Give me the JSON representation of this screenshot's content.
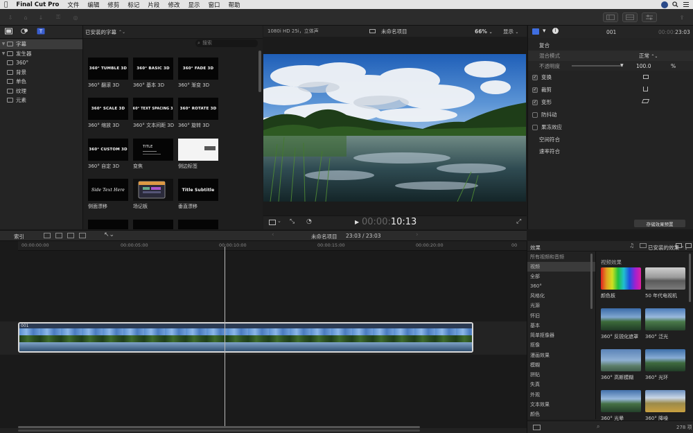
{
  "menubar": {
    "app_name": "Final Cut Pro",
    "items": [
      "文件",
      "编辑",
      "修剪",
      "标记",
      "片段",
      "修改",
      "显示",
      "窗口",
      "帮助"
    ]
  },
  "library": {
    "items": [
      {
        "label": "字幕",
        "expanded": true,
        "selected": true,
        "level": 0
      },
      {
        "label": "发生器",
        "expanded": true,
        "selected": false,
        "level": 0
      },
      {
        "label": "360°",
        "selected": false,
        "level": 1
      },
      {
        "label": "背景",
        "selected": false,
        "level": 1
      },
      {
        "label": "单色",
        "selected": false,
        "level": 1
      },
      {
        "label": "纹理",
        "selected": false,
        "level": 1
      },
      {
        "label": "元素",
        "selected": false,
        "level": 1
      }
    ]
  },
  "browser": {
    "title": "已安装的字幕",
    "search_placeholder": "搜索",
    "titles": [
      {
        "thumb": "360° TUMBLE 3D",
        "label": "360° 翻滚 3D"
      },
      {
        "thumb": "360° BASIC 3D",
        "label": "360° 基本 3D"
      },
      {
        "thumb": "360° FADE 3D",
        "label": "360° 渐变 3D"
      },
      {
        "thumb": "360° SCALE 3D",
        "label": "360° 缩放 3D"
      },
      {
        "thumb": "360° TEXT SPACING 3D",
        "label": "360° 文本间距 3D"
      },
      {
        "thumb": "360° ROTATE 3D",
        "label": "360° 旋转 3D"
      },
      {
        "thumb": "360° CUSTOM 3D",
        "label": "360° 自定 3D"
      },
      {
        "thumb": "TITLE",
        "label": "变焦"
      },
      {
        "thumb": "",
        "label": "侧边标签"
      },
      {
        "thumb": "Side Text Here",
        "label": "侧面漂移"
      },
      {
        "thumb": "",
        "label": "场记板"
      },
      {
        "thumb": "Title Subtitle",
        "label": "垂直漂移"
      }
    ]
  },
  "viewer": {
    "format": "1080i HD 25i，立体声",
    "project_name": "未命名项目",
    "zoom": "66%",
    "display_menu": "显示",
    "timecode_dim": "00:00:",
    "timecode": "10:13"
  },
  "inspector": {
    "clip_name": "001",
    "timecode_dim": "00:00:",
    "timecode": "23:03",
    "composite_label": "复合",
    "blend_mode_label": "混合模式",
    "blend_mode_value": "正常",
    "opacity_label": "不透明度",
    "opacity_value": "100.0",
    "opacity_unit": "%",
    "sections": [
      {
        "label": "变换",
        "checked": true
      },
      {
        "label": "裁剪",
        "checked": true
      },
      {
        "label": "变形",
        "checked": true
      },
      {
        "label": "防抖动",
        "checked": false
      },
      {
        "label": "果冻效应",
        "checked": false
      },
      {
        "label": "空间符合",
        "checked": null
      },
      {
        "label": "速率符合",
        "checked": null
      }
    ],
    "save_preset": "存储效果预置"
  },
  "timeline": {
    "index_label": "索引",
    "project_name": "未命名项目",
    "duration": "23:03 / 23:03",
    "ruler_ticks": [
      "00:00:00:00",
      "00:00:05:00",
      "00:00:10:00",
      "00:00:15:00",
      "00:00:20:00",
      "00"
    ],
    "clip_name": "001"
  },
  "effects": {
    "title": "效果",
    "installed": "已安装的效果",
    "categories": [
      "所有视频和音频",
      "视频",
      "全部",
      "360°",
      "风格化",
      "光源",
      "怀旧",
      "基本",
      "简单抠像器",
      "抠像",
      "漫画效果",
      "模糊",
      "拼贴",
      "失真",
      "外观",
      "文本效果",
      "颜色"
    ],
    "section_title": "视频效果",
    "items": [
      {
        "label": "颜色板",
        "style": "color-board"
      },
      {
        "label": "50 年代电视机",
        "style": "bw"
      },
      {
        "label": "360° 反锐化遮罩",
        "style": "mountain"
      },
      {
        "label": "360° 泛光",
        "style": "mountain"
      },
      {
        "label": "360° 高斯模糊",
        "style": "blur"
      },
      {
        "label": "360° 光环",
        "style": "mountain"
      },
      {
        "label": "360° 光晕",
        "style": "mountain"
      },
      {
        "label": "360° 降噪",
        "style": "mountain-warm"
      }
    ],
    "count": "278 项"
  }
}
